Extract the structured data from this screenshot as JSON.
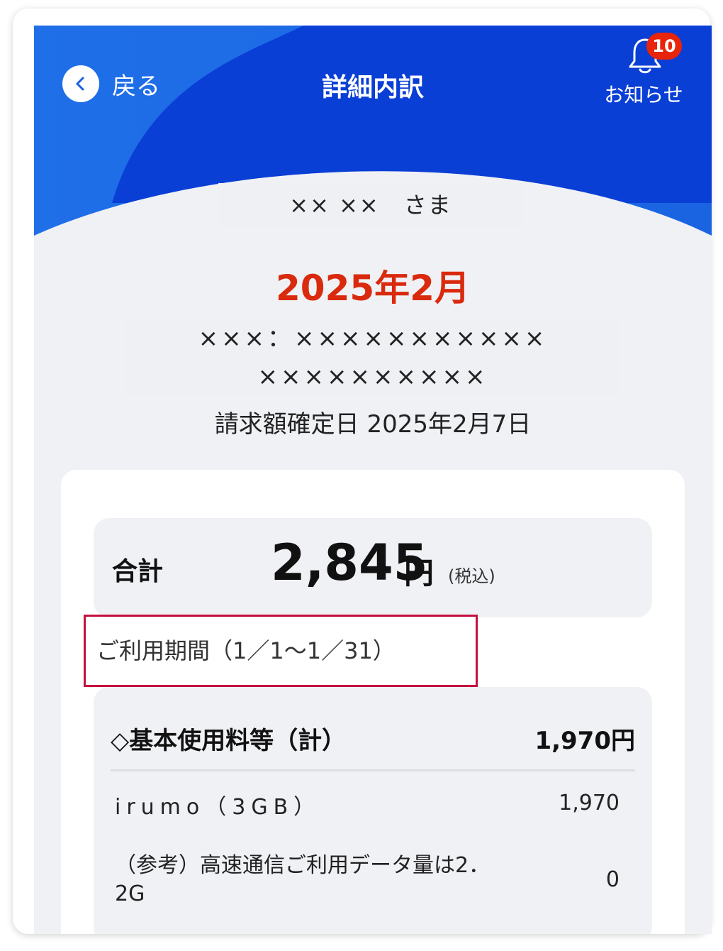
{
  "header": {
    "back_label": "戻る",
    "title": "詳細内訳",
    "notice_label": "お知らせ",
    "notice_count": "10"
  },
  "customer_name": "×× ××　さま",
  "billing_month": "2025年2月",
  "contract_line1": "×××：×××××××××××",
  "contract_line2": "××××××××××",
  "confirm_date": "請求額確定日 2025年2月7日",
  "total": {
    "label": "合計",
    "amount": "2,845",
    "currency": "円",
    "tax_note": "(税込)"
  },
  "period": "ご利用期間（1／1〜1／31）",
  "detail": {
    "heading": "◇基本使用料等（計）",
    "heading_total": "1,970円",
    "rows": [
      {
        "label": "irumo（3GB）",
        "value": "1,970"
      },
      {
        "label": "（参考）高速通信ご利用データ量は2．2G",
        "value": "0"
      }
    ]
  },
  "colors": {
    "header_blue": "#0a3fd6",
    "accent_red": "#d92a0e",
    "highlight_border": "#c4103e",
    "badge_red": "#e8240a"
  },
  "icons": {
    "back": "chevron-left-icon",
    "notice": "bell-icon"
  }
}
